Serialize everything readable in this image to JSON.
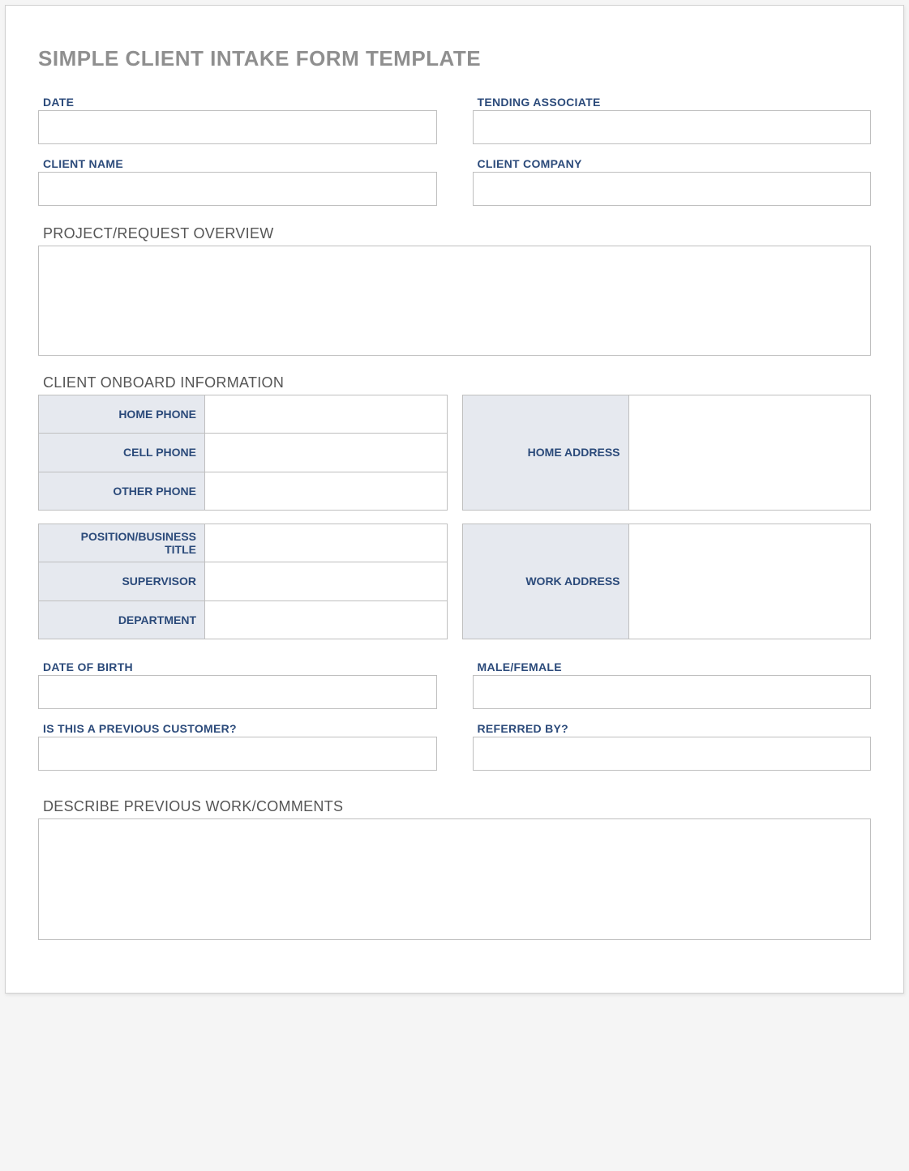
{
  "title": "SIMPLE CLIENT INTAKE FORM TEMPLATE",
  "fields": {
    "date_label": "DATE",
    "tending_associate_label": "TENDING ASSOCIATE",
    "client_name_label": "CLIENT NAME",
    "client_company_label": "CLIENT COMPANY",
    "date_value": "",
    "tending_associate_value": "",
    "client_name_value": "",
    "client_company_value": ""
  },
  "sections": {
    "project_overview_label": "PROJECT/REQUEST OVERVIEW",
    "project_overview_value": "",
    "onboard_label": "CLIENT ONBOARD INFORMATION",
    "describe_label": "DESCRIBE PREVIOUS WORK/COMMENTS",
    "describe_value": ""
  },
  "onboard_left1": [
    {
      "label": "HOME PHONE",
      "value": ""
    },
    {
      "label": "CELL PHONE",
      "value": ""
    },
    {
      "label": "OTHER PHONE",
      "value": ""
    }
  ],
  "onboard_right1": {
    "label": "HOME ADDRESS",
    "value": ""
  },
  "onboard_left2": [
    {
      "label": "POSITION/BUSINESS TITLE",
      "value": ""
    },
    {
      "label": "SUPERVISOR",
      "value": ""
    },
    {
      "label": "DEPARTMENT",
      "value": ""
    }
  ],
  "onboard_right2": {
    "label": "WORK ADDRESS",
    "value": ""
  },
  "bottom_fields": {
    "dob_label": "DATE OF BIRTH",
    "dob_value": "",
    "gender_label": "MALE/FEMALE",
    "gender_value": "",
    "prev_customer_label": "IS THIS A PREVIOUS CUSTOMER?",
    "prev_customer_value": "",
    "referred_label": "REFERRED BY?",
    "referred_value": ""
  }
}
